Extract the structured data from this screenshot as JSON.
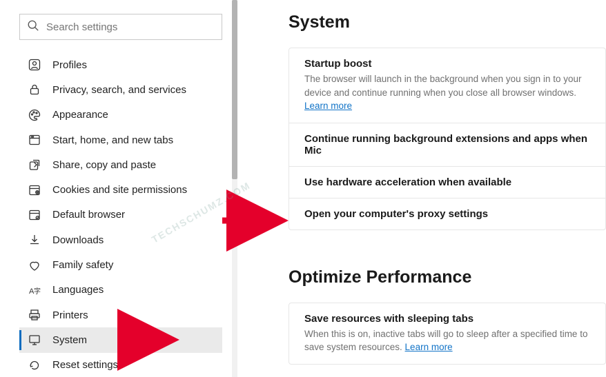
{
  "search": {
    "placeholder": "Search settings"
  },
  "sidebar": {
    "items": [
      {
        "label": "Profiles"
      },
      {
        "label": "Privacy, search, and services"
      },
      {
        "label": "Appearance"
      },
      {
        "label": "Start, home, and new tabs"
      },
      {
        "label": "Share, copy and paste"
      },
      {
        "label": "Cookies and site permissions"
      },
      {
        "label": "Default browser"
      },
      {
        "label": "Downloads"
      },
      {
        "label": "Family safety"
      },
      {
        "label": "Languages"
      },
      {
        "label": "Printers"
      },
      {
        "label": "System"
      },
      {
        "label": "Reset settings"
      }
    ]
  },
  "main": {
    "title1": "System",
    "startup": {
      "title": "Startup boost",
      "desc": "The browser will launch in the background when you sign in to your device and continue running when you close all browser windows. ",
      "learn": "Learn more"
    },
    "bgExt": {
      "title": "Continue running background extensions and apps when Mic"
    },
    "hw": {
      "title": "Use hardware acceleration when available"
    },
    "proxy": {
      "title": "Open your computer's proxy settings"
    },
    "title2": "Optimize Performance",
    "sleep": {
      "title": "Save resources with sleeping tabs",
      "desc": "When this is on, inactive tabs will go to sleep after a specified time to save system resources. ",
      "learn": "Learn more"
    }
  },
  "watermark": "TECHSCHUMZ.COM"
}
